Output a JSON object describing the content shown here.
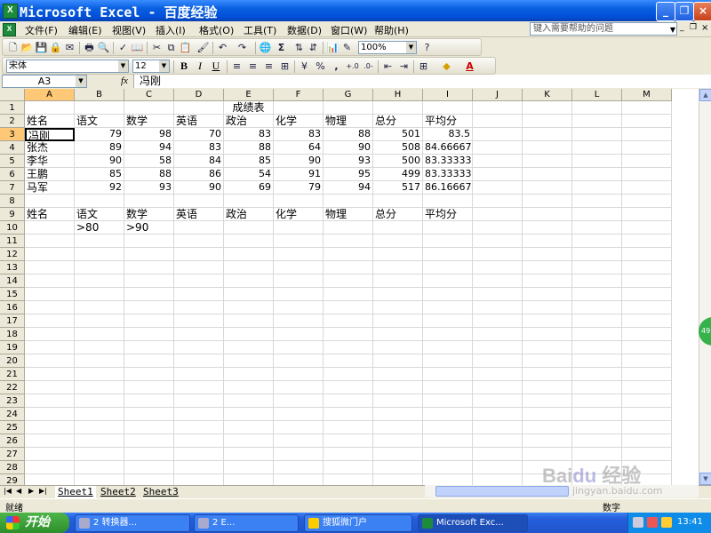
{
  "window": {
    "title": "Microsoft Excel - 百度经验",
    "controls": [
      "_",
      "❐",
      "×"
    ],
    "doc_controls": [
      "_",
      "❐",
      "×"
    ]
  },
  "menu": {
    "items": [
      "文件(F)",
      "编辑(E)",
      "视图(V)",
      "插入(I)",
      "格式(O)",
      "工具(T)",
      "数据(D)",
      "窗口(W)",
      "帮助(H)"
    ],
    "help_placeholder": "键入需要帮助的问题"
  },
  "toolbar": {
    "zoom": "100%",
    "font_name": "宋体",
    "font_size": "12",
    "bold": "B",
    "italic": "I",
    "underline": "U",
    "percent": "%",
    "comma": ",",
    "sum": "Σ"
  },
  "formula_bar": {
    "name_box": "A3",
    "fx": "fx",
    "value": "冯刚"
  },
  "columns": [
    "A",
    "B",
    "C",
    "D",
    "E",
    "F",
    "G",
    "H",
    "I",
    "J",
    "K",
    "L",
    "M"
  ],
  "rows": [
    "1",
    "2",
    "3",
    "4",
    "5",
    "6",
    "7",
    "8",
    "9",
    "10",
    "11",
    "12",
    "13",
    "14",
    "15",
    "16",
    "17",
    "18",
    "19",
    "20",
    "21",
    "22",
    "23",
    "24",
    "25",
    "26",
    "27",
    "28",
    "29"
  ],
  "sheet": {
    "title": "成绩表",
    "header": [
      "姓名",
      "语文",
      "数学",
      "英语",
      "政治",
      "化学",
      "物理",
      "总分",
      "平均分"
    ],
    "records": [
      [
        "冯刚",
        "79",
        "98",
        "70",
        "83",
        "83",
        "88",
        "501",
        "83.5"
      ],
      [
        "张杰",
        "89",
        "94",
        "83",
        "88",
        "64",
        "90",
        "508",
        "84.66667"
      ],
      [
        "李华",
        "90",
        "58",
        "84",
        "85",
        "90",
        "93",
        "500",
        "83.33333"
      ],
      [
        "王鹏",
        "85",
        "88",
        "86",
        "54",
        "91",
        "95",
        "499",
        "83.33333"
      ],
      [
        "马军",
        "92",
        "93",
        "90",
        "69",
        "79",
        "94",
        "517",
        "86.16667"
      ]
    ],
    "criteria_header": [
      "姓名",
      "语文",
      "数学",
      "英语",
      "政治",
      "化学",
      "物理",
      "总分",
      "平均分"
    ],
    "criteria": [
      "",
      ">80",
      ">90"
    ]
  },
  "tabs": [
    "Sheet1",
    "Sheet2",
    "Sheet3"
  ],
  "status": {
    "left": "就绪",
    "right": "数字"
  },
  "taskbar": {
    "start": "开始",
    "buttons": [
      "2 转换器...",
      "2 E...",
      "搜狐微门户",
      "Microsoft Exc..."
    ],
    "clock": "13:41"
  },
  "watermark": {
    "logo": "Baidu经验",
    "url": "jingyan.baidu.com"
  },
  "side_badge": "49"
}
